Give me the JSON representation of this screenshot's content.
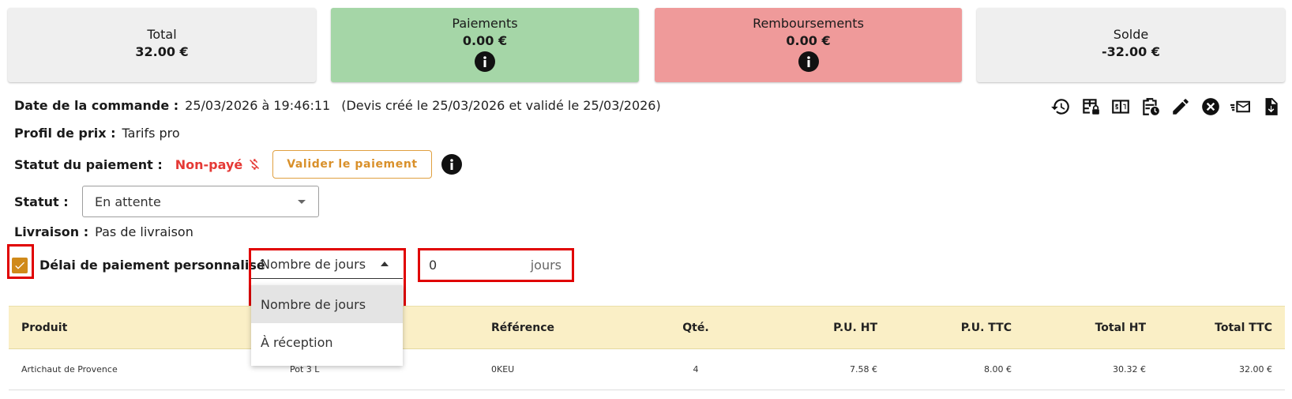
{
  "summary": {
    "total": {
      "title": "Total",
      "amount": "32.00 €"
    },
    "payments": {
      "title": "Paiements",
      "amount": "0.00 €"
    },
    "refunds": {
      "title": "Remboursements",
      "amount": "0.00 €"
    },
    "balance": {
      "title": "Solde",
      "amount": "-32.00 €"
    }
  },
  "order": {
    "date_label": "Date de la commande :",
    "date_value": "25/03/2026 à 19:46:11",
    "quote_note": "(Devis créé le 25/03/2026 et validé le 25/03/2026)",
    "profile_label": "Profil de prix :",
    "profile_value": "Tarifs pro",
    "payment_status_label": "Statut du paiement :",
    "payment_status_value": "Non-payé",
    "validate_payment_label": "Valider le paiement",
    "status_label": "Statut :",
    "status_value": "En attente",
    "delivery_label": "Livraison :",
    "delivery_value": "Pas de livraison",
    "custom_delay_label": "Délai de paiement personnalisé",
    "custom_delay_checked": true,
    "delay_type_value": "Nombre de jours",
    "delay_options": [
      "Nombre de jours",
      "À réception"
    ],
    "delay_days_value": "0",
    "delay_days_unit": "jours"
  },
  "toolbar_icons": [
    "history-icon",
    "table-lock-icon",
    "scoreboard-icon",
    "clipboard-clock-icon",
    "pencil-icon",
    "cancel-circle-icon",
    "email-fast-icon",
    "file-download-icon"
  ],
  "table": {
    "headers": [
      "Produit",
      "",
      "Référence",
      "Qté.",
      "P.U. HT",
      "P.U. TTC",
      "Total HT",
      "Total TTC"
    ],
    "rows": [
      [
        "Artichaut de Provence",
        "Pot 3 L",
        "0KEU",
        "4",
        "7.58 €",
        "8.00 €",
        "30.32 €",
        "32.00 €"
      ]
    ]
  },
  "colors": {
    "payments_bg": "#a5d6a7",
    "refunds_bg": "#ef9a9a",
    "unpaid_text": "#e53935",
    "accent": "#d08a1a",
    "table_header_bg": "#faefc6",
    "highlight": "#e00000"
  }
}
